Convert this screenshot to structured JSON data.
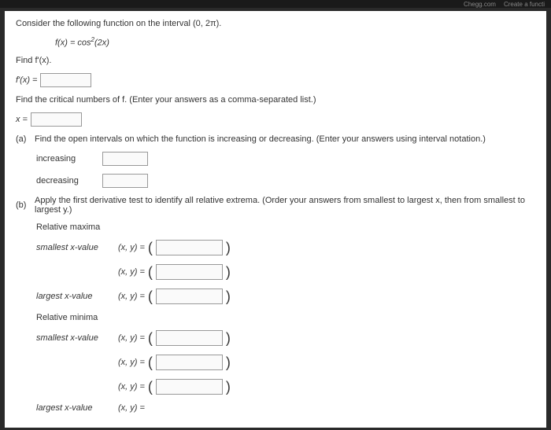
{
  "topbar": {
    "chegg": "Chegg.com",
    "create": "Create a functi"
  },
  "problem": {
    "intro": "Consider the following function on the interval (0, 2π).",
    "function_lhs": "f(x) = ",
    "function_rhs_base": "cos",
    "function_rhs_exp": "2",
    "function_rhs_arg": "(2x)",
    "find_fprime": "Find f'(x).",
    "fprime_eq": "f'(x) =",
    "find_critical": "Find the critical numbers of f. (Enter your answers as a comma-separated list.)",
    "x_eq": "x =",
    "part_a_label": "(a)",
    "part_a_text": "Find the open intervals on which the function is increasing or decreasing. (Enter your answers using interval notation.)",
    "increasing": "increasing",
    "decreasing": "decreasing",
    "part_b_label": "(b)",
    "part_b_text": "Apply the first derivative test to identify all relative extrema. (Order your answers from smallest to largest x, then from smallest to largest y.)",
    "rel_maxima": "Relative maxima",
    "smallest_x": "smallest x-value",
    "largest_x": "largest x-value",
    "rel_minima": "Relative minima",
    "xy_eq": "(x, y)  ="
  }
}
